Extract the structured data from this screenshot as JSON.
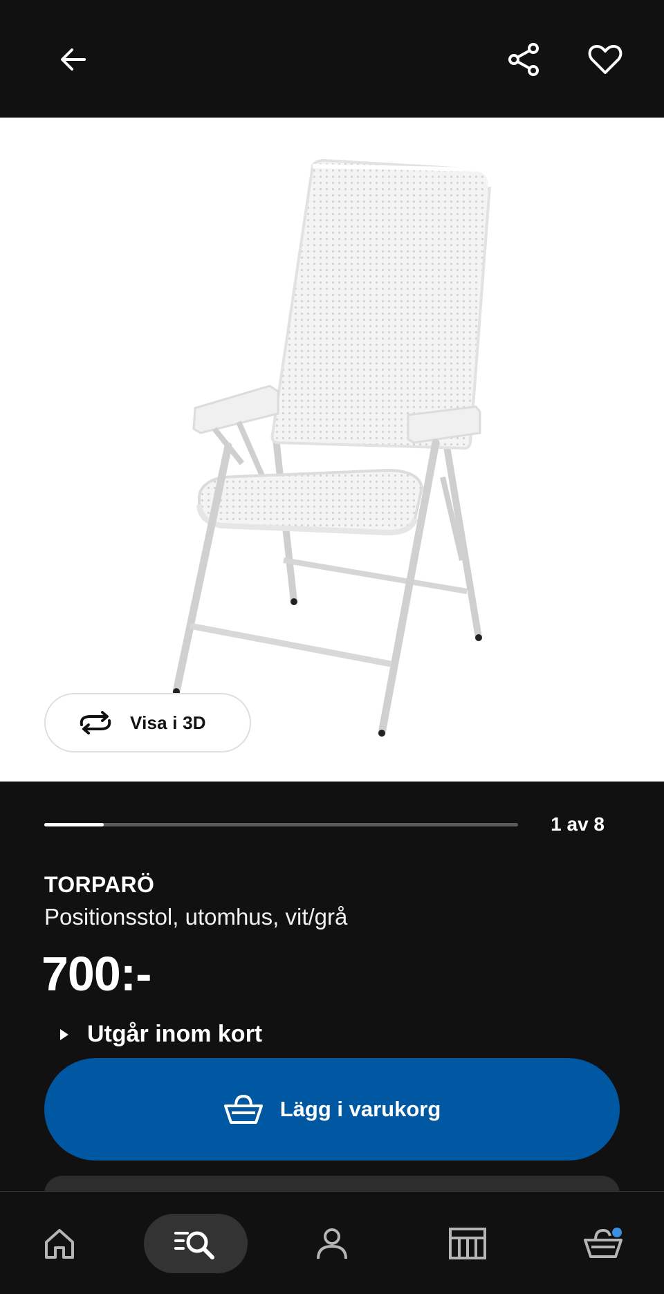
{
  "header": {
    "back_icon": "arrow-left-icon",
    "share_icon": "share-icon",
    "favorite_icon": "heart-icon"
  },
  "gallery": {
    "view3d_label": "Visa i 3D",
    "view3d_icon": "rotate-3d-icon",
    "counter": "1 av 8",
    "current_index": 1,
    "total_images": 8
  },
  "product": {
    "name": "TORPARÖ",
    "description": "Positionsstol, utomhus, vit/grå",
    "price": "700:-",
    "notice": "Utgår inom kort"
  },
  "actions": {
    "add_to_cart_label": "Lägg i varukorg",
    "add_to_cart_icon": "basket-icon"
  },
  "bottom_nav": {
    "items": [
      {
        "icon": "home-icon",
        "active": false
      },
      {
        "icon": "search-list-icon",
        "active": true
      },
      {
        "icon": "profile-icon",
        "active": false
      },
      {
        "icon": "store-icon",
        "active": false
      },
      {
        "icon": "cart-icon",
        "active": false,
        "badge": true
      }
    ]
  },
  "colors": {
    "background": "#111111",
    "primary_button": "#0058a3",
    "badge": "#3d8fe0"
  }
}
